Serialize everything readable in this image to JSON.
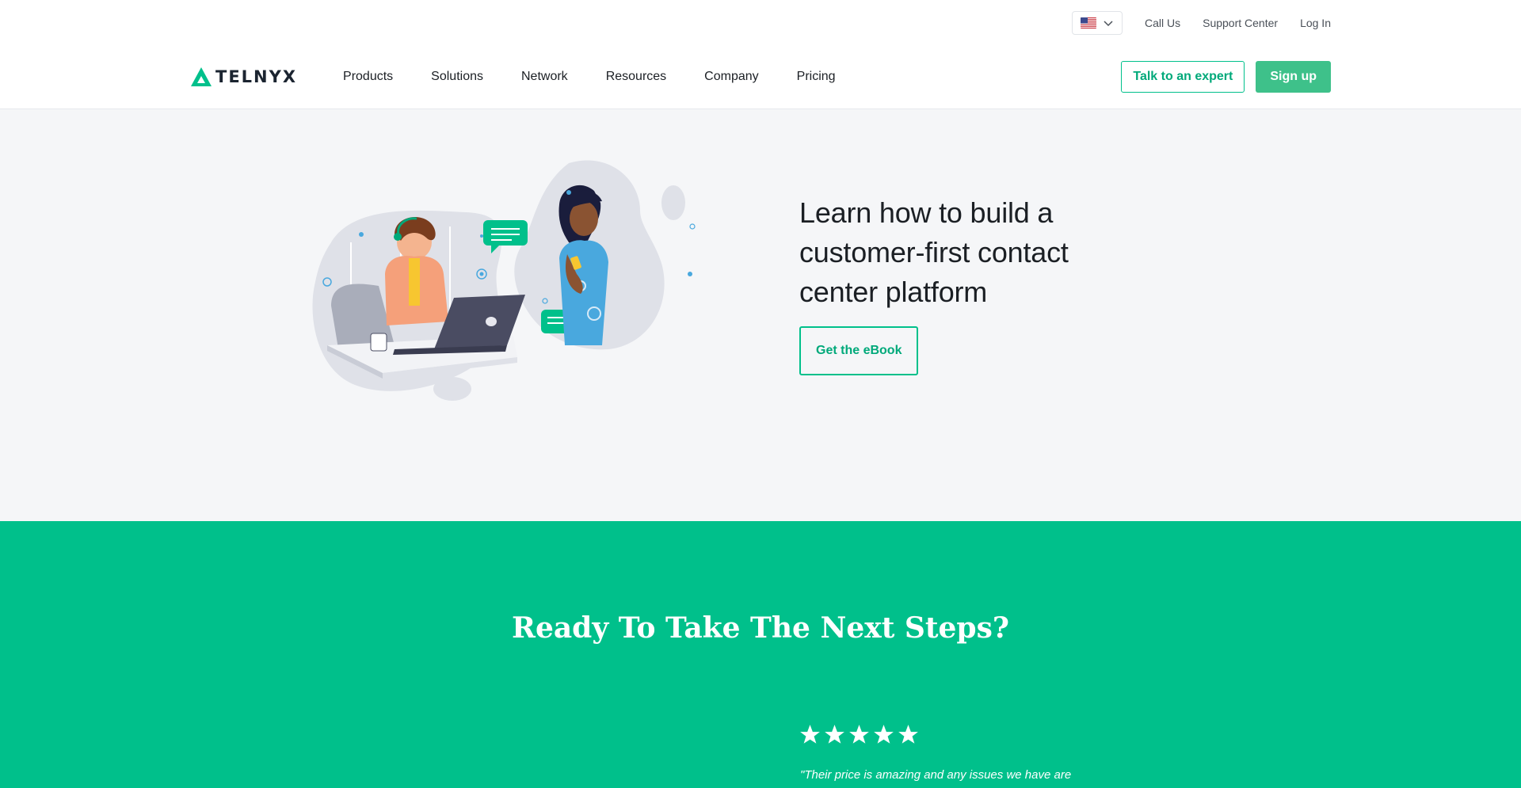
{
  "utility": {
    "language_flag": "us-flag-icon",
    "call_us": "Call Us",
    "support_center": "Support Center",
    "log_in": "Log In"
  },
  "brand": {
    "name": "TELNYX",
    "accent": "#00c08b"
  },
  "nav": {
    "items": [
      "Products",
      "Solutions",
      "Network",
      "Resources",
      "Company",
      "Pricing"
    ],
    "talk_to_expert": "Talk to an expert",
    "sign_up": "Sign up"
  },
  "hero": {
    "title": "Learn how to build a customer-first contact center platform",
    "cta": "Get the eBook"
  },
  "next_steps": {
    "title": "Ready To Take The Next Steps?",
    "rating": 5,
    "quote": "\"Their price is amazing and any issues we have are"
  }
}
